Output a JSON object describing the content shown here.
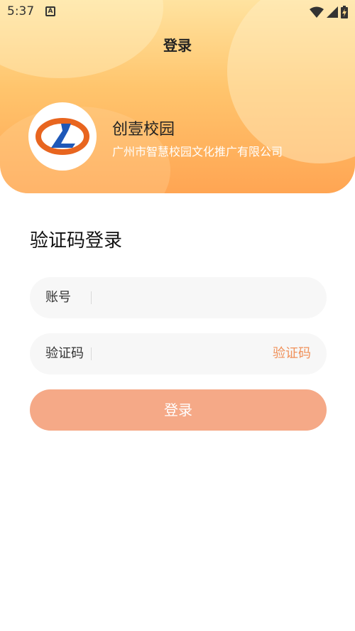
{
  "status_bar": {
    "time": "5:37",
    "a_icon_letter": "A"
  },
  "header": {
    "title": "登录"
  },
  "school": {
    "name": "创壹校园",
    "company": "广州市智慧校园文化推广有限公司"
  },
  "form": {
    "title": "验证码登录",
    "account": {
      "label": "账号",
      "value": "",
      "placeholder": ""
    },
    "code": {
      "label": "验证码",
      "value": "",
      "placeholder": "",
      "get_code_label": "验证码"
    },
    "login_label": "登录"
  },
  "colors": {
    "accent": "#F0915A",
    "login_button": "#F5A987",
    "header_top": "#FFE3A0",
    "header_bottom": "#FFA553",
    "logo_blue": "#1E58B8",
    "logo_orange": "#E8651F"
  }
}
